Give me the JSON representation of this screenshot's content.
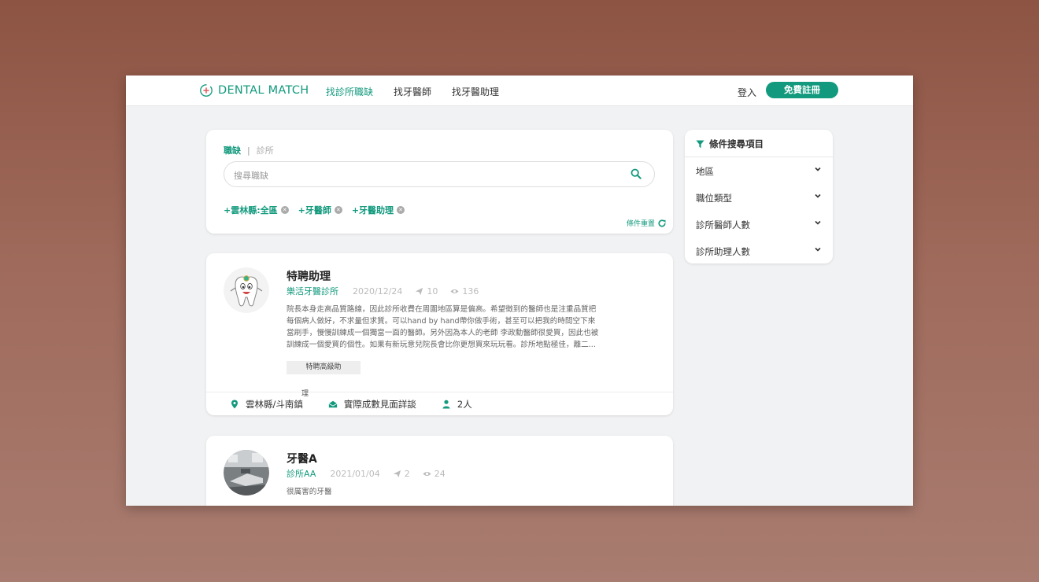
{
  "brand": {
    "name": "DENTAL MATCH",
    "color": "#139a7e"
  },
  "nav": {
    "links": [
      "找診所職缺",
      "找牙醫師",
      "找牙醫助理"
    ],
    "login": "登入",
    "register": "免費註冊"
  },
  "search": {
    "tab_active": "職缺",
    "tab_sep": "|",
    "tab_inactive": "診所",
    "placeholder": "搜尋職缺",
    "chips": [
      "+雲林縣:全區",
      "+牙醫師",
      "+牙醫助理"
    ],
    "reset_label": "條件重置"
  },
  "filters": {
    "header": "條件搜尋項目",
    "items": [
      "地區",
      "職位類型",
      "診所醫師人數",
      "診所助理人數"
    ]
  },
  "jobs": [
    {
      "title": "特聘助理",
      "clinic": "樂活牙醫診所",
      "date": "2020/12/24",
      "sends": "10",
      "views": "136",
      "description_lines": [
        "院長本身走高品質路線，因此診所收費在周圍地區算是偏高。希望徵到的醫師也是注重品質把",
        "每個病人做好，不求量但求質。可以hand by hand帶你做手術，甚至可以把我的時間空下來",
        "當刷手，慢慢訓練成一個獨當一面的醫師。另外因為本人的老師 李政勳醫師很愛買，因此也被",
        "訓練成一個愛買的個性。如果有新玩意兒院長會比你更想買來玩玩看。診所地點極佳，離二..."
      ],
      "tag": "特聘高級助",
      "tag_overflow": "理",
      "location": "雲林縣/斗南鎮",
      "salary": "實際成數見面詳談",
      "headcount": "2人"
    },
    {
      "title": "牙醫A",
      "clinic": "診所AA",
      "date": "2021/01/04",
      "sends": "2",
      "views": "24",
      "description_lines": [
        "很厲害的牙醫"
      ]
    }
  ]
}
